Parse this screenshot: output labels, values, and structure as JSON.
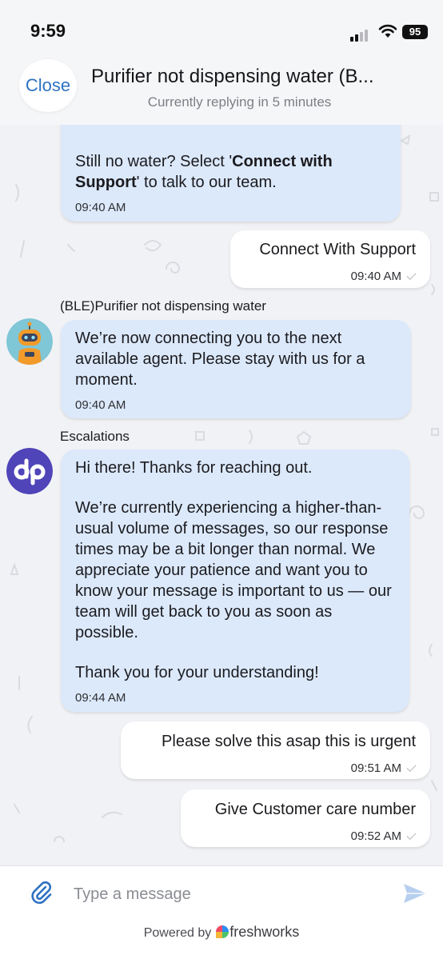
{
  "status_bar": {
    "time": "9:59",
    "battery": "95"
  },
  "header": {
    "close_label": "Close",
    "title": "Purifier not dispensing water (B...",
    "subtitle": "Currently replying in 5 minutes"
  },
  "messages": [
    {
      "direction": "in",
      "text_before": "Still no water? Select '",
      "bold": "Connect with Support",
      "text_after": "' to talk to our team.",
      "time": "09:40 AM"
    },
    {
      "direction": "out",
      "text": "Connect With Support",
      "time": "09:40 AM"
    },
    {
      "direction": "in",
      "sender": "(BLE)Purifier not dispensing water",
      "avatar": "robot-bot",
      "text": "We’re now connecting you to the next available agent. Please stay with us for a moment.",
      "time": "09:40 AM"
    },
    {
      "direction": "in",
      "sender": "Escalations",
      "avatar": "dp-logo",
      "paragraphs": [
        "Hi there! Thanks for reaching out.",
        "We’re currently experiencing a higher-than-usual volume of messages, so our response times may be a bit longer than normal. We appreciate your patience and want you to know your message is important to us — our team will get back to you as soon as possible.",
        "Thank you for your understanding!"
      ],
      "time": "09:44 AM"
    },
    {
      "direction": "out",
      "text": "Please solve this asap this is urgent",
      "time": "09:51 AM"
    },
    {
      "direction": "out",
      "text": "Give Customer care number",
      "time": "09:52 AM"
    }
  ],
  "composer": {
    "placeholder": "Type a message",
    "powered_by": "Powered by",
    "brand": "freshworks"
  },
  "colors": {
    "accent": "#2f72c2",
    "incoming_bubble": "#dce9fb",
    "outgoing_bubble": "#ffffff",
    "dp_logo": "#4f44b8"
  }
}
